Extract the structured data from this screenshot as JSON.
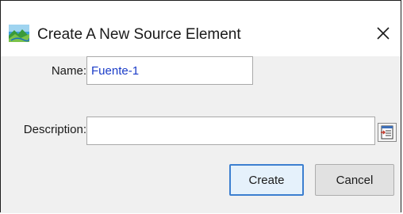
{
  "window": {
    "title": "Create A New Source Element",
    "close_glyph": "X",
    "icon": "landscape-app-icon"
  },
  "form": {
    "name_label": "Name:",
    "name_value": "Fuente-1",
    "description_label": "Description:",
    "description_value": "",
    "description_editor_icon": "text-editor-icon"
  },
  "buttons": {
    "create_label": "Create",
    "cancel_label": "Cancel"
  },
  "colors": {
    "input_text": "#1a3cc8",
    "create_border": "#3c7fd0",
    "dialog_bg": "#f0f0f0"
  }
}
